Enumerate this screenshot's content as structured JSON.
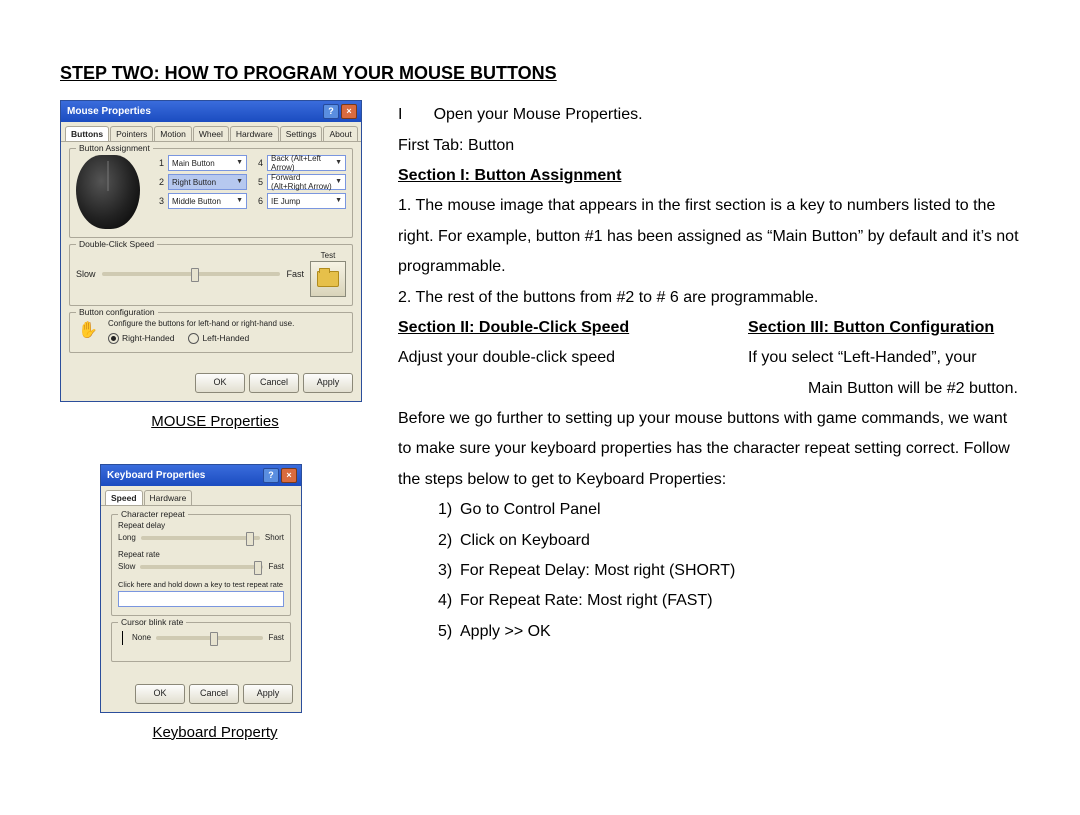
{
  "title": "STEP TWO:   HOW TO PROGRAM YOUR MOUSE BUTTONS",
  "captions": {
    "mouse": "MOUSE Properties",
    "keyboard": "Keyboard Property"
  },
  "mouse_win": {
    "title": "Mouse Properties",
    "tabs": [
      "Buttons",
      "Pointers",
      "Motion",
      "Wheel",
      "Hardware",
      "Settings",
      "About"
    ],
    "group_assign": "Button Assignment",
    "assignments": {
      "n1": "1",
      "v1": "Main Button",
      "n2": "2",
      "v2": "Right Button",
      "n3": "3",
      "v3": "Middle Button",
      "n4": "4",
      "v4": "Back (Alt+Left Arrow)",
      "n5": "5",
      "v5": "Forward (Alt+Right Arrow)",
      "n6": "6",
      "v6": "IE Jump"
    },
    "group_dbl": "Double-Click Speed",
    "dbl_slow": "Slow",
    "dbl_fast": "Fast",
    "dbl_test": "Test",
    "group_cfg": "Button configuration",
    "cfg_hint": "Configure the buttons for left-hand or right-hand use.",
    "cfg_right": "Right-Handed",
    "cfg_left": "Left-Handed",
    "ok": "OK",
    "cancel": "Cancel",
    "apply": "Apply"
  },
  "kbd_win": {
    "title": "Keyboard Properties",
    "tabs": [
      "Speed",
      "Hardware"
    ],
    "group_repeat": "Character repeat",
    "r_delay": "Repeat delay",
    "r_long": "Long",
    "r_short": "Short",
    "r_rate": "Repeat rate",
    "r_slow": "Slow",
    "r_fast": "Fast",
    "r_hint": "Click here and hold down a key to test repeat rate",
    "group_blink": "Cursor blink rate",
    "b_none": "None",
    "b_fast": "Fast",
    "ok": "OK",
    "cancel": "Cancel",
    "apply": "Apply"
  },
  "text": {
    "open1": "I       Open your Mouse Properties.",
    "open2": "First Tab:   Button",
    "sec1": "Section I:   Button Assignment",
    "p1": "1.    The mouse image that appears in the first section is a key to numbers listed to the right.   For example, button #1 has been assigned as “Main Button” by default and it’s not programmable.",
    "p2": "2.    The rest of the buttons from #2 to # 6 are programmable.",
    "sec2": "Section II:   Double-Click Speed",
    "sec3": "Section III:   Button Configuration",
    "sec2_body": "Adjust your double-click speed",
    "sec3_body1": "If you select “Left-Handed”, your",
    "sec3_body2": "Main Button will be #2 button.",
    "para_kb": "Before we go further to setting up your mouse buttons with game commands, we want to make sure your keyboard properties has the character repeat setting correct.   Follow the steps below to get to Keyboard Properties:",
    "li1n": "1)",
    "li1": "Go to Control Panel",
    "li2n": "2)",
    "li2": "Click on Keyboard",
    "li3n": "3)",
    "li3": "For Repeat Delay:   Most right (SHORT)",
    "li4n": "4)",
    "li4": "For Repeat Rate:   Most right (FAST)",
    "li5n": "5)",
    "li5": "Apply >> OK"
  }
}
